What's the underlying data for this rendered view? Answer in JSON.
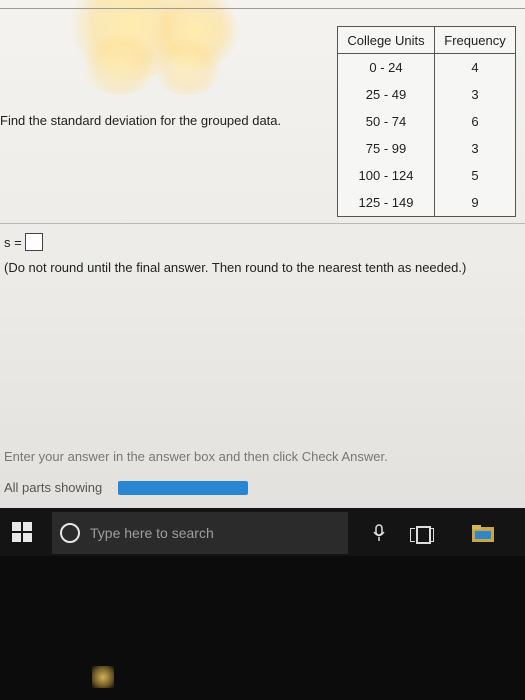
{
  "question": {
    "prompt": "Find the standard deviation for the grouped data.",
    "answer_label": "s =",
    "answer_value": "",
    "instruction": "(Do not round until the final answer. Then round to the nearest tenth as needed.)"
  },
  "table": {
    "headers": [
      "College Units",
      "Frequency"
    ],
    "rows": [
      {
        "units": "0 - 24",
        "frequency": "4"
      },
      {
        "units": "25 - 49",
        "frequency": "3"
      },
      {
        "units": "50 - 74",
        "frequency": "6"
      },
      {
        "units": "75 - 99",
        "frequency": "3"
      },
      {
        "units": "100 - 124",
        "frequency": "5"
      },
      {
        "units": "125 - 149",
        "frequency": "9"
      }
    ]
  },
  "footer": {
    "hint": "Enter your answer in the answer box and then click Check Answer.",
    "parts_label": "All parts showing",
    "progress_fraction": 1.0
  },
  "taskbar": {
    "search_placeholder": "Type here to search",
    "icons": [
      "windows-start-icon",
      "search-circle-icon",
      "microphone-icon",
      "task-view-icon",
      "file-explorer-icon"
    ]
  },
  "colors": {
    "progress_fill": "#2a86d1",
    "taskbar_bg": "#141414",
    "screen_bg": "#efeeeb"
  }
}
